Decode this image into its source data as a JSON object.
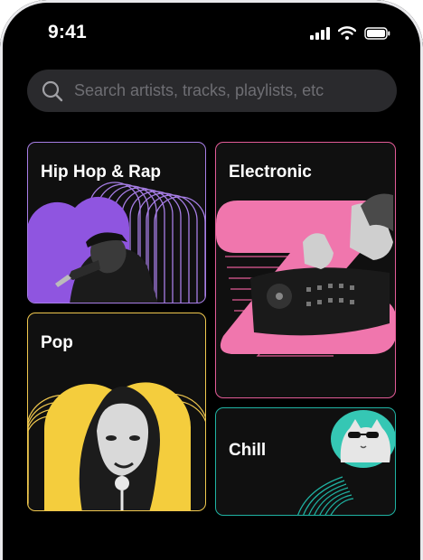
{
  "status_bar": {
    "time": "9:41",
    "icons": [
      "cellular-signal-icon",
      "wifi-icon",
      "battery-icon"
    ]
  },
  "search": {
    "placeholder": "Search artists, tracks, playlists, etc"
  },
  "genres": [
    {
      "label": "Hip Hop & Rap",
      "color": "#a77ee6"
    },
    {
      "label": "Electronic",
      "color": "#e35b97"
    },
    {
      "label": "Pop",
      "color": "#f0c84e"
    },
    {
      "label": "Chill",
      "color": "#1fb3a3"
    }
  ],
  "theme": {
    "background": "#000000",
    "search_background": "#2a2a2d",
    "placeholder_color": "#6e6e73"
  }
}
